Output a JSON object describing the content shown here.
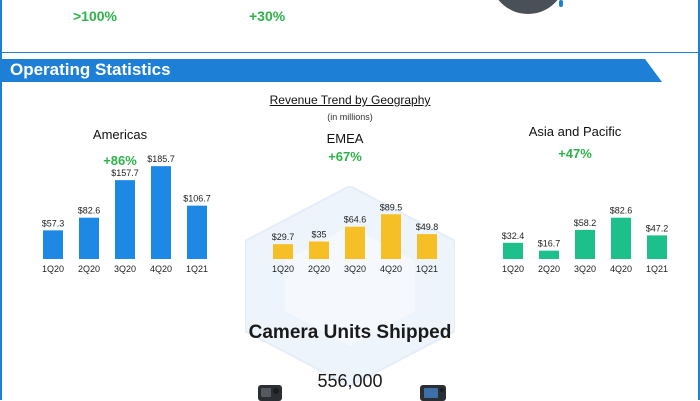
{
  "header": {
    "growth_left": ">100%",
    "growth_right": "+30%"
  },
  "section": {
    "title": "Operating Statistics"
  },
  "trend": {
    "title": "Revenue Trend by Geography",
    "subtitle": "(in millions)"
  },
  "colors": {
    "brand_blue": "#1e7fd6",
    "growth_green": "#2db34a",
    "americas_bar": "#1e88e5",
    "emea_bar": "#f6bf26",
    "apac_bar": "#1dbf8a"
  },
  "chart_data": [
    {
      "type": "bar",
      "title": "Americas",
      "growth": "+86%",
      "categories": [
        "1Q20",
        "2Q20",
        "3Q20",
        "4Q20",
        "1Q21"
      ],
      "values": [
        57.3,
        82.6,
        157.7,
        185.7,
        106.7
      ],
      "value_labels": [
        "$57.3",
        "$82.6",
        "$157.7",
        "$185.7",
        "$106.7"
      ]
    },
    {
      "type": "bar",
      "title": "EMEA",
      "growth": "+67%",
      "categories": [
        "1Q20",
        "2Q20",
        "3Q20",
        "4Q20",
        "1Q21"
      ],
      "values": [
        29.7,
        35,
        64.6,
        89.5,
        49.8
      ],
      "value_labels": [
        "$29.7",
        "$35",
        "$64.6",
        "$89.5",
        "$49.8"
      ]
    },
    {
      "type": "bar",
      "title": "Asia and Pacific",
      "growth": "+47%",
      "categories": [
        "1Q20",
        "2Q20",
        "3Q20",
        "4Q20",
        "1Q21"
      ],
      "values": [
        32.4,
        16.7,
        58.2,
        82.6,
        47.2
      ],
      "value_labels": [
        "$32.4",
        "$16.7",
        "$58.2",
        "$82.6",
        "$47.2"
      ]
    }
  ],
  "camera": {
    "title": "Camera Units Shipped",
    "count": "556,000"
  }
}
